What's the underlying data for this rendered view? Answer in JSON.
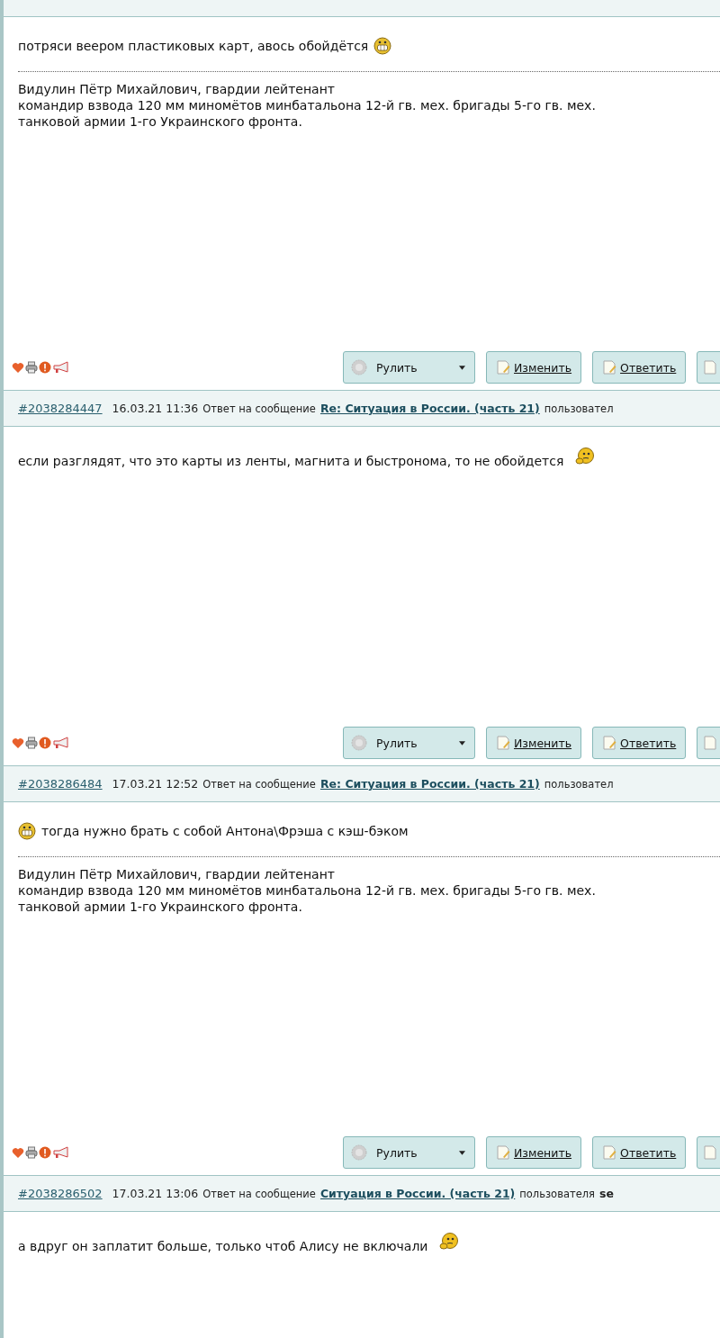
{
  "posts": [
    {
      "message": [
        {
          "kind": "text",
          "text": "потряси веером пластиковых карт, авось обойдётся"
        },
        {
          "kind": "grin"
        }
      ],
      "signature": [
        "Видулин Пётр Михайлович, гвардии лейтенант",
        "командир взвода 120 мм миномётов минбатальона 12-й гв. мех. бригады 5-го гв. мех.",
        "танковой армии 1-го Украинского фронта."
      ],
      "buttons": [
        {
          "kind": "dropdown",
          "label": "Рулить"
        },
        {
          "kind": "link",
          "label": "Изменить"
        },
        {
          "kind": "link",
          "label": "Ответить"
        },
        {
          "kind": "cut"
        }
      ]
    },
    {
      "header": {
        "id": "#2038284447",
        "date": "16.03.21 11:36",
        "reply_text": "Ответ на сообщение",
        "topic": "Re: Ситуация в России. (часть 21)",
        "user_text": "пользовател"
      },
      "message": [
        {
          "kind": "text",
          "text": "если разглядят, что это карты из ленты, магнита и быстронома, то не обойдется"
        },
        {
          "kind": "think"
        }
      ],
      "buttons": [
        {
          "kind": "dropdown",
          "label": "Рулить"
        },
        {
          "kind": "link",
          "label": "Изменить"
        },
        {
          "kind": "link",
          "label": "Ответить"
        },
        {
          "kind": "cut"
        }
      ]
    },
    {
      "header": {
        "id": "#2038286484",
        "date": "17.03.21 12:52",
        "reply_text": "Ответ на сообщение",
        "topic": "Re: Ситуация в России. (часть 21)",
        "user_text": "пользовател"
      },
      "message": [
        {
          "kind": "grin"
        },
        {
          "kind": "text",
          "text": "тогда нужно брать с собой Антона\\Фрэша с кэш-бэком"
        }
      ],
      "signature": [
        "Видулин Пётр Михайлович, гвардии лейтенант",
        "командир взвода 120 мм миномётов минбатальона 12-й гв. мех. бригады 5-го гв. мех.",
        "танковой армии 1-го Украинского фронта."
      ],
      "buttons": [
        {
          "kind": "dropdown",
          "label": "Рулить"
        },
        {
          "kind": "link",
          "label": "Изменить"
        },
        {
          "kind": "link",
          "label": "Ответить"
        },
        {
          "kind": "cut"
        }
      ]
    },
    {
      "header": {
        "id": "#2038286502",
        "date": "17.03.21 13:06",
        "reply_text": "Ответ на сообщение",
        "topic": "Ситуация в России. (часть 21)",
        "user_text": "пользователя",
        "user": "se"
      },
      "message": [
        {
          "kind": "text",
          "text": "а вдруг он заплатит больше, только чтоб Алису не включали"
        },
        {
          "kind": "think"
        }
      ]
    }
  ]
}
